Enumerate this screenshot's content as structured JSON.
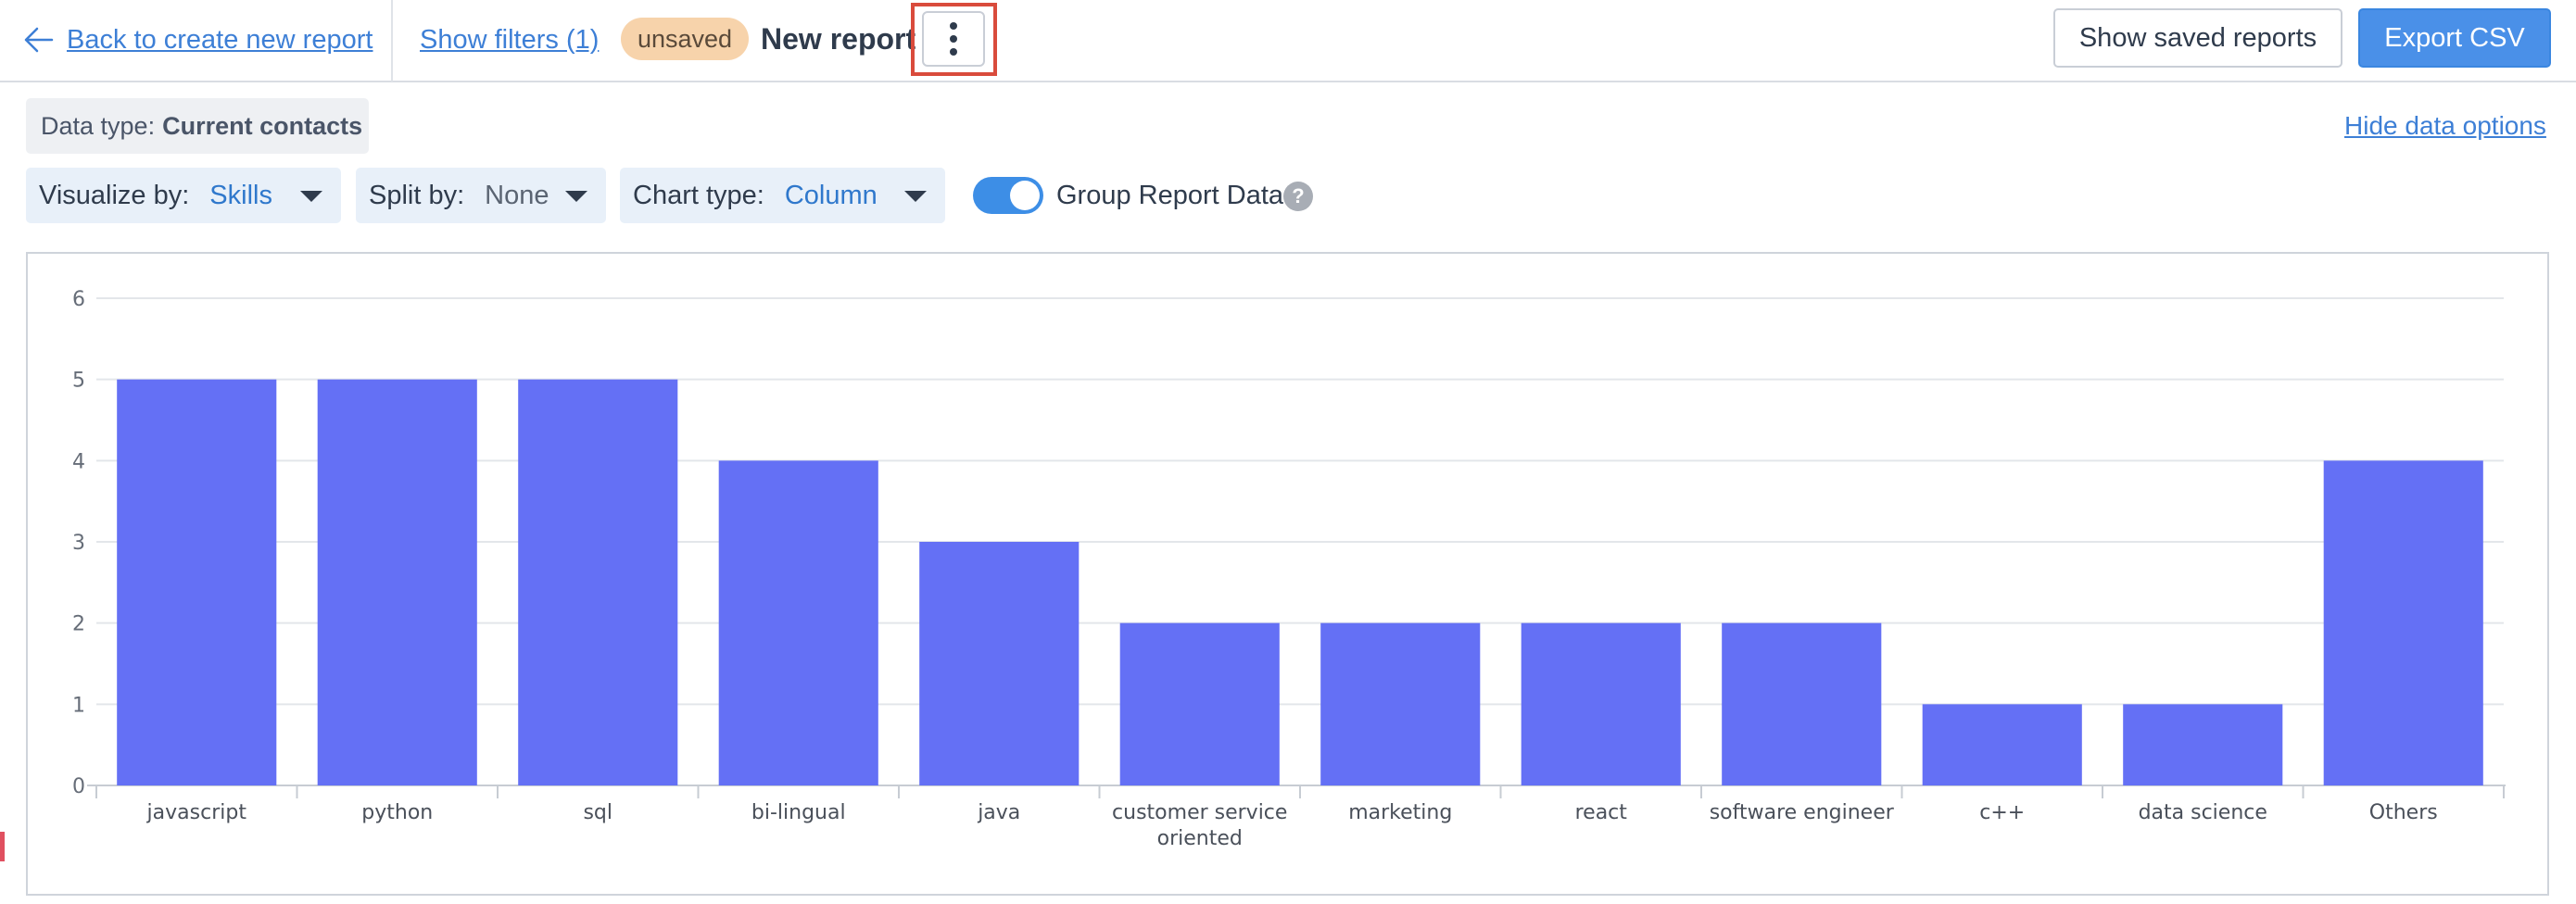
{
  "topbar": {
    "back_label": "Back to create new report",
    "filters_label": "Show filters (1)",
    "status_badge": "unsaved",
    "report_title": "New report",
    "saved_reports_label": "Show saved reports",
    "export_label": "Export CSV"
  },
  "options": {
    "data_type_label": "Data type:",
    "data_type_value": "Current contacts",
    "hide_options_label": "Hide data options",
    "visualize_by": {
      "label": "Visualize by:",
      "value": "Skills"
    },
    "split_by": {
      "label": "Split by:",
      "value": "None"
    },
    "chart_type": {
      "label": "Chart type:",
      "value": "Column"
    },
    "group_toggle": {
      "label": "Group Report Data",
      "on": true
    },
    "help_icon": "?"
  },
  "colors": {
    "bar": "#6470f5",
    "accent": "#4a90e8",
    "link": "#3d7fd6",
    "badge": "#f7d3ab"
  },
  "chart_data": {
    "type": "bar",
    "categories": [
      "javascript",
      "python",
      "sql",
      "bi-lingual",
      "java",
      "customer service oriented",
      "marketing",
      "react",
      "software engineer",
      "c++",
      "data science",
      "Others"
    ],
    "category_lines": [
      [
        "javascript"
      ],
      [
        "python"
      ],
      [
        "sql"
      ],
      [
        "bi-lingual"
      ],
      [
        "java"
      ],
      [
        "customer service",
        "oriented"
      ],
      [
        "marketing"
      ],
      [
        "react"
      ],
      [
        "software engineer"
      ],
      [
        "c++"
      ],
      [
        "data science"
      ],
      [
        "Others"
      ]
    ],
    "values": [
      5,
      5,
      5,
      4,
      3,
      2,
      2,
      2,
      2,
      1,
      1,
      4
    ],
    "title": "",
    "xlabel": "",
    "ylabel": "",
    "ylim": [
      0,
      6
    ],
    "yticks": [
      0,
      1,
      2,
      3,
      4,
      5,
      6
    ],
    "grid": true,
    "legend": "none"
  }
}
